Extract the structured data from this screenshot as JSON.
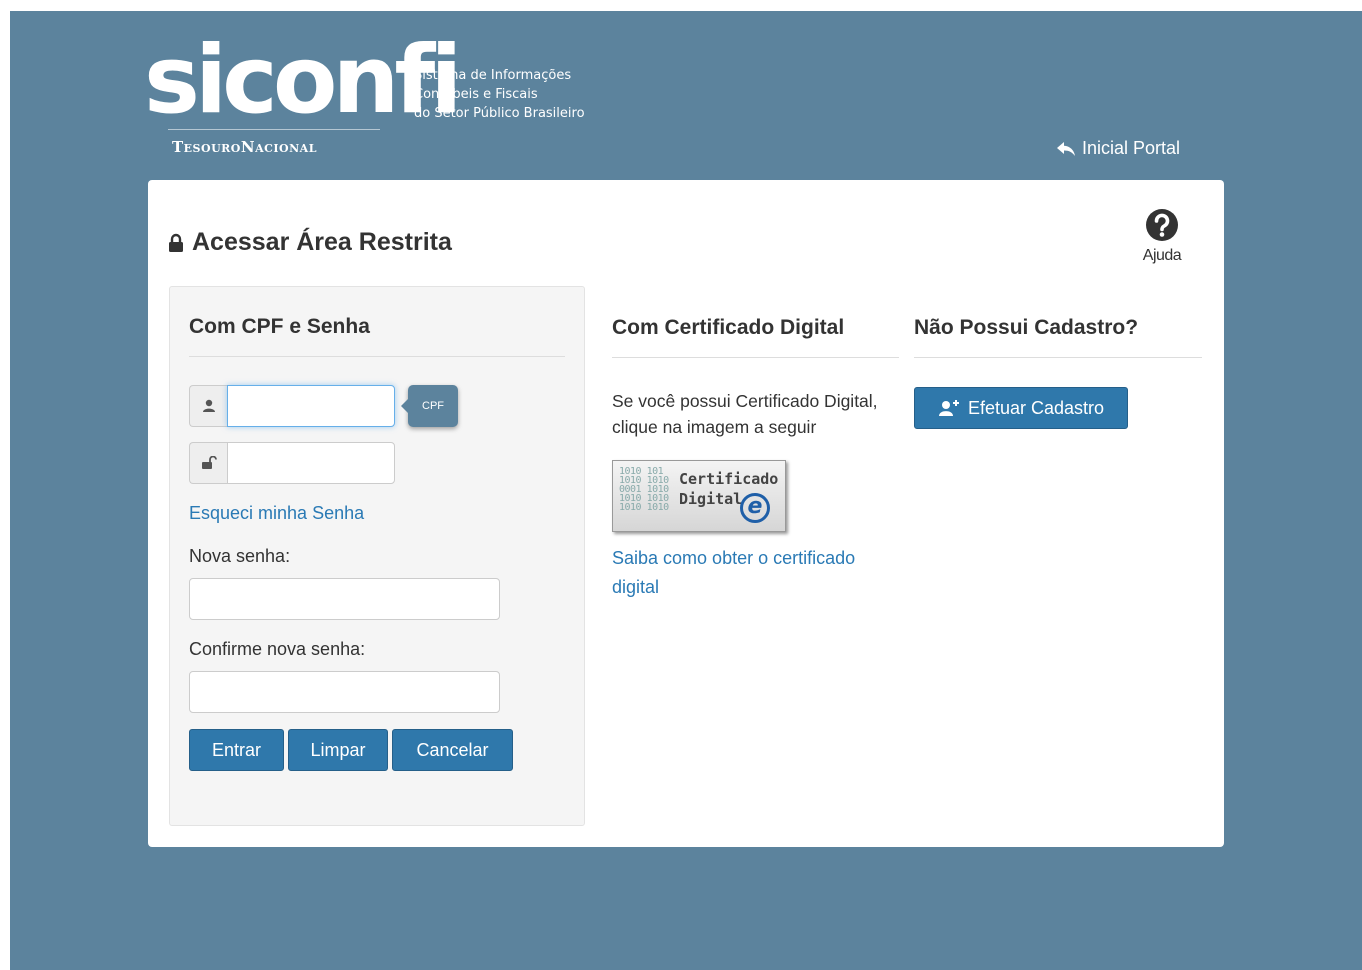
{
  "header": {
    "logo_word": "siconfi",
    "tagline": [
      "Sistema de Informações",
      "Contábeis e Fiscais",
      "do Setor Público Brasileiro"
    ],
    "org": "TesouroNacional",
    "home_link": "Inicial Portal"
  },
  "panel": {
    "title": "Acessar Área Restrita",
    "help_label": "Ajuda"
  },
  "cpf": {
    "heading": "Com CPF e Senha",
    "cpf_value": "",
    "cpf_tooltip": "CPF",
    "password_value": "",
    "forgot_link": "Esqueci minha Senha",
    "new_password_label": "Nova senha:",
    "confirm_password_label": "Confirme nova senha:",
    "buttons": {
      "enter": "Entrar",
      "clear": "Limpar",
      "cancel": "Cancelar"
    }
  },
  "certificate": {
    "heading": "Com Certificado Digital",
    "text": "Se você possui Certificado Digital, clique na imagem a seguir",
    "image_line1": "Certificado",
    "image_line2": "Digital",
    "link": "Saiba como obter o certificado digital"
  },
  "register": {
    "heading": "Não Possui Cadastro?",
    "button": "Efetuar Cadastro"
  },
  "colors": {
    "background": "#5c839d",
    "primary": "#2f78ab",
    "link": "#2a7ab5"
  }
}
